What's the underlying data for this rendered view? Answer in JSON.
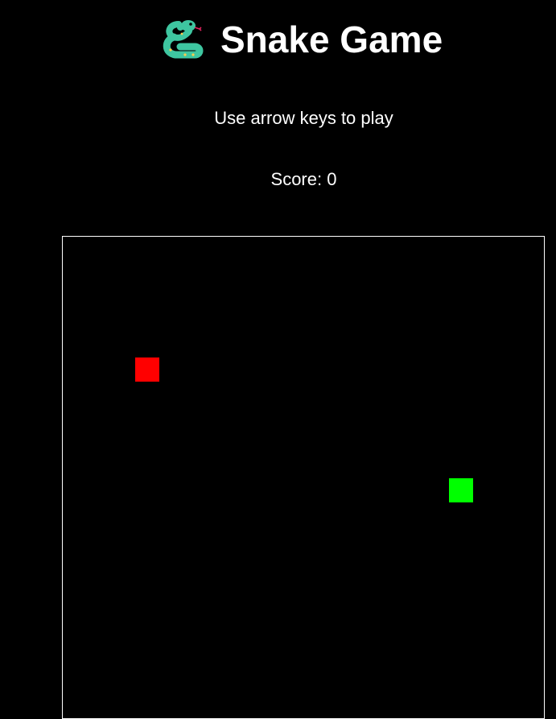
{
  "header": {
    "title": "Snake Game",
    "icon": "snake-icon"
  },
  "instructions": "Use arrow keys to play",
  "score": {
    "label": "Score:",
    "value": 0
  },
  "board": {
    "grid_cols": 20,
    "grid_rows": 20,
    "border_color": "#ffffff",
    "background": "#000000",
    "food": {
      "col": 3,
      "row": 5,
      "color": "#ff0000"
    },
    "snake": {
      "color": "#00ff00",
      "segments": [
        {
          "col": 16,
          "row": 10
        }
      ]
    }
  }
}
